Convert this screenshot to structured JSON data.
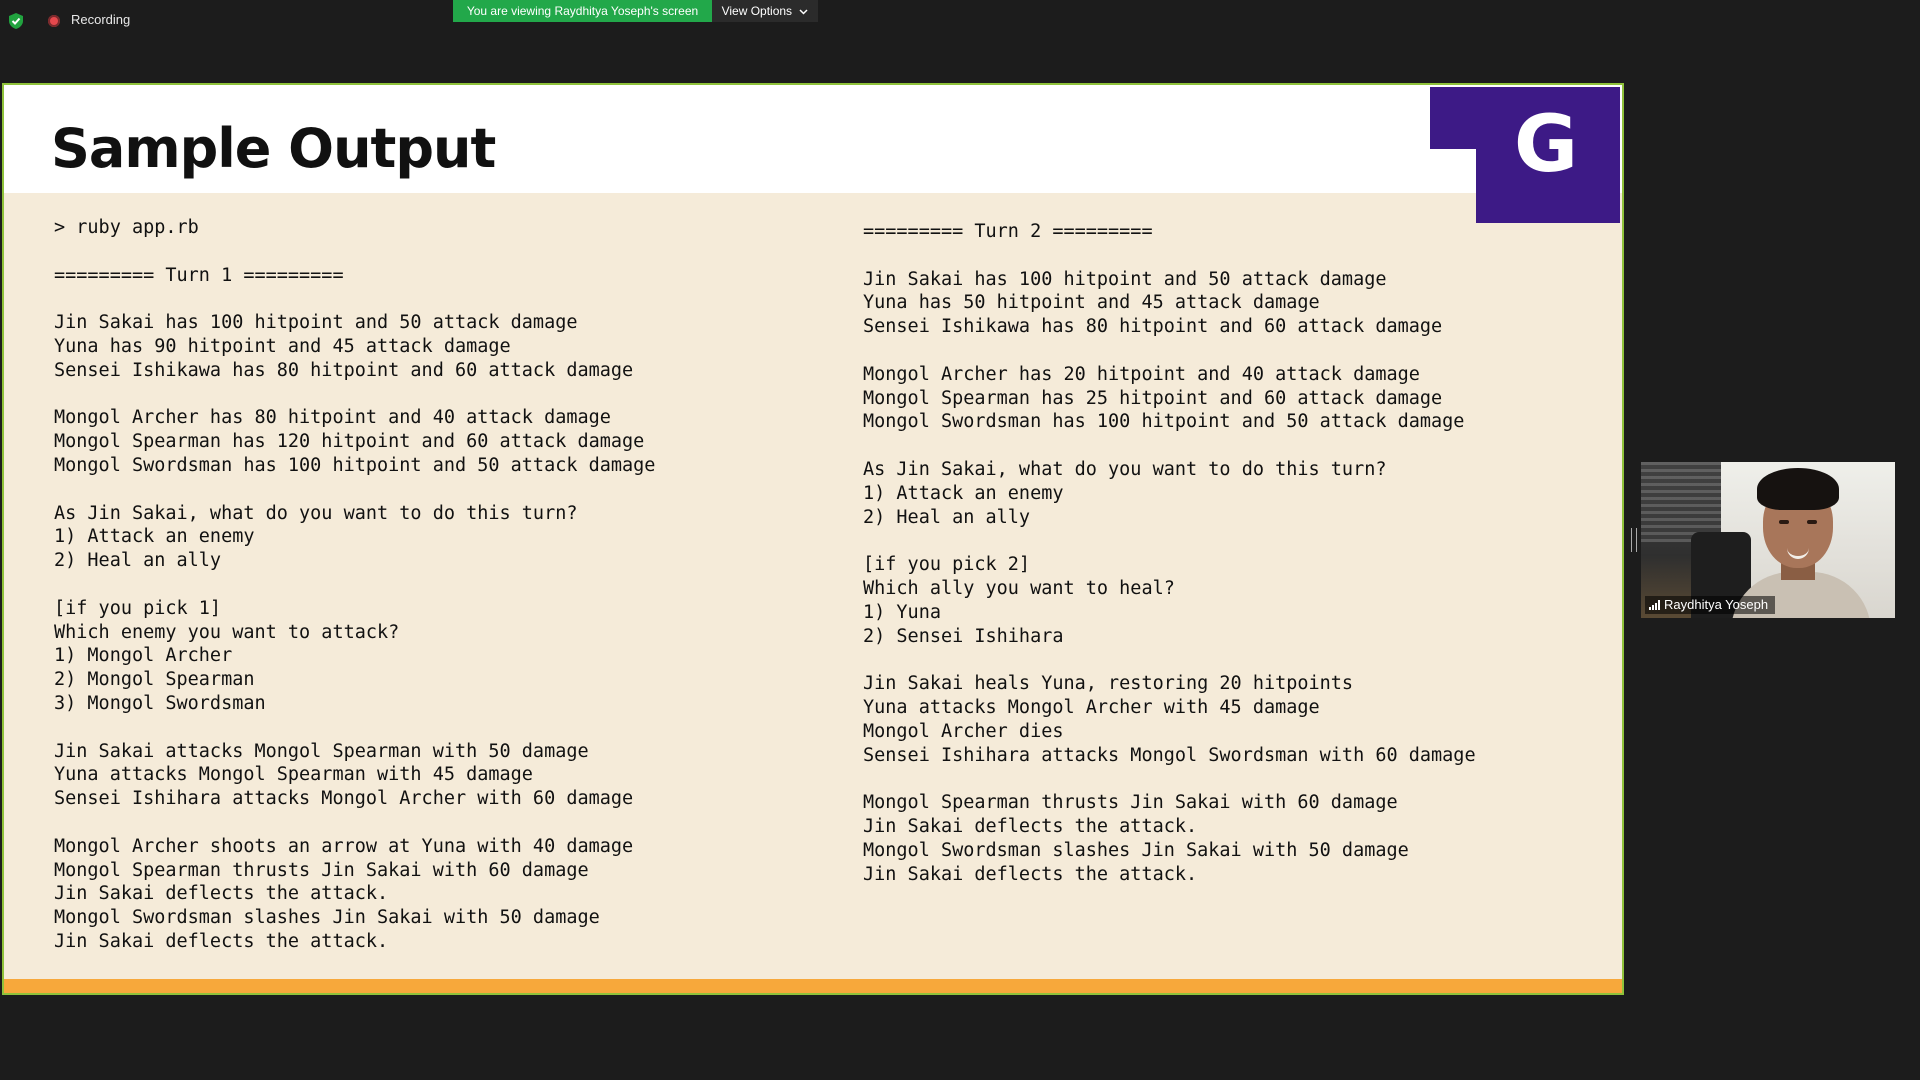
{
  "top_bar": {
    "recording_label": "Recording",
    "viewing_notice": "You are viewing Raydhitya Yoseph's screen",
    "view_options_label": "View Options"
  },
  "slide": {
    "title": "Sample Output",
    "logo_letter": "G",
    "left_lines": [
      "> ruby app.rb",
      "",
      "========= Turn 1 =========",
      "",
      "Jin Sakai has 100 hitpoint and 50 attack damage",
      "Yuna has 90 hitpoint and 45 attack damage",
      "Sensei Ishikawa has 80 hitpoint and 60 attack damage",
      "",
      "Mongol Archer has 80 hitpoint and 40 attack damage",
      "Mongol Spearman has 120 hitpoint and 60 attack damage",
      "Mongol Swordsman has 100 hitpoint and 50 attack damage",
      "",
      "As Jin Sakai, what do you want to do this turn?",
      "1) Attack an enemy",
      "2) Heal an ally",
      "",
      "[if you pick 1]",
      "Which enemy you want to attack?",
      "1) Mongol Archer",
      "2) Mongol Spearman",
      "3) Mongol Swordsman",
      "",
      "Jin Sakai attacks Mongol Spearman with 50 damage",
      "Yuna attacks Mongol Spearman with 45 damage",
      "Sensei Ishihara attacks Mongol Archer with 60 damage",
      "",
      "Mongol Archer shoots an arrow at Yuna with 40 damage",
      "Mongol Spearman thrusts Jin Sakai with 60 damage",
      "Jin Sakai deflects the attack.",
      "Mongol Swordsman slashes Jin Sakai with 50 damage",
      "Jin Sakai deflects the attack."
    ],
    "right_lines": [
      "========= Turn 2 =========",
      "",
      "Jin Sakai has 100 hitpoint and 50 attack damage",
      "Yuna has 50 hitpoint and 45 attack damage",
      "Sensei Ishikawa has 80 hitpoint and 60 attack damage",
      "",
      "Mongol Archer has 20 hitpoint and 40 attack damage",
      "Mongol Spearman has 25 hitpoint and 60 attack damage",
      "Mongol Swordsman has 100 hitpoint and 50 attack damage",
      "",
      "As Jin Sakai, what do you want to do this turn?",
      "1) Attack an enemy",
      "2) Heal an ally",
      "",
      "[if you pick 2]",
      "Which ally you want to heal?",
      "1) Yuna",
      "2) Sensei Ishihara",
      "",
      "Jin Sakai heals Yuna, restoring 20 hitpoints",
      "Yuna attacks Mongol Archer with 45 damage",
      "Mongol Archer dies",
      "Sensei Ishihara attacks Mongol Swordsman with 60 damage",
      "",
      "Mongol Spearman thrusts Jin Sakai with 60 damage",
      "Jin Sakai deflects the attack.",
      "Mongol Swordsman slashes Jin Sakai with 50 damage",
      "Jin Sakai deflects the attack."
    ]
  },
  "video_tile": {
    "participant_name": "Raydhitya Yoseph"
  },
  "colors": {
    "viewing_badge": "#22a84a",
    "slide_border": "#8fc23a",
    "slide_bg": "#f5ebd9",
    "logo_purple": "#3d1a86",
    "footer_orange": "#f7a83b",
    "recording_red": "#e5484d"
  }
}
